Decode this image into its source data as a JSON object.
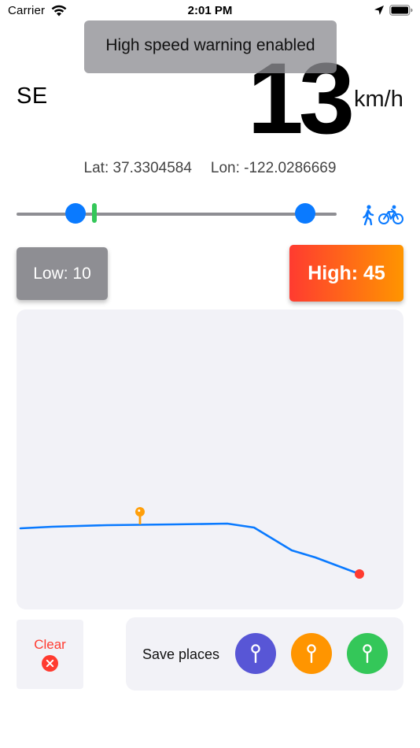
{
  "status_bar": {
    "carrier": "Carrier",
    "time": "2:01 PM"
  },
  "toast": {
    "message": "High speed warning enabled"
  },
  "speed": {
    "direction": "SE",
    "value": "13",
    "unit": "km/h"
  },
  "location": {
    "lat_label": "Lat: 37.3304584",
    "lon_label": "Lon: -122.0286669"
  },
  "speed_range_slider": {
    "low": 10,
    "high": 45,
    "current": 13,
    "mode_icons": [
      "walking-icon",
      "bicycle-icon"
    ],
    "track_color": "#8e8e93",
    "knob_color": "#0a7aff",
    "marker_color": "#34c759"
  },
  "thresholds": {
    "low_label": "Low: 10",
    "high_label": "High: 45",
    "low_color": "#8e8e93",
    "high_gradient": [
      "#ff3b30",
      "#ff9500"
    ]
  },
  "track_map": {
    "line_color": "#0a7aff",
    "pin_color": "#ff9f0a",
    "end_point_color": "#ff3b30"
  },
  "clear": {
    "label": "Clear",
    "color": "#ff3b30"
  },
  "save_places": {
    "label": "Save places",
    "pins": [
      {
        "name": "purple",
        "color": "#5856d6"
      },
      {
        "name": "orange",
        "color": "#ff9500"
      },
      {
        "name": "green",
        "color": "#34c759"
      }
    ]
  }
}
